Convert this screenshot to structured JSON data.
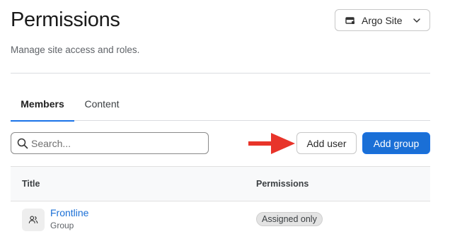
{
  "header": {
    "title": "Permissions",
    "subtitle": "Manage site access and roles."
  },
  "site_selector": {
    "label": "Argo Site",
    "icon": "site-icon"
  },
  "tabs": [
    {
      "label": "Members",
      "active": true
    },
    {
      "label": "Content",
      "active": false
    }
  ],
  "search": {
    "placeholder": "Search...",
    "value": ""
  },
  "toolbar": {
    "add_user_label": "Add user",
    "add_group_label": "Add group"
  },
  "table": {
    "columns": [
      "Title",
      "Permissions"
    ],
    "rows": [
      {
        "name": "Frontline",
        "type": "Group",
        "permission": "Assigned only",
        "icon": "group-icon"
      }
    ]
  },
  "colors": {
    "accent": "#1a6fd6",
    "annotation_arrow": "#e8342a"
  }
}
